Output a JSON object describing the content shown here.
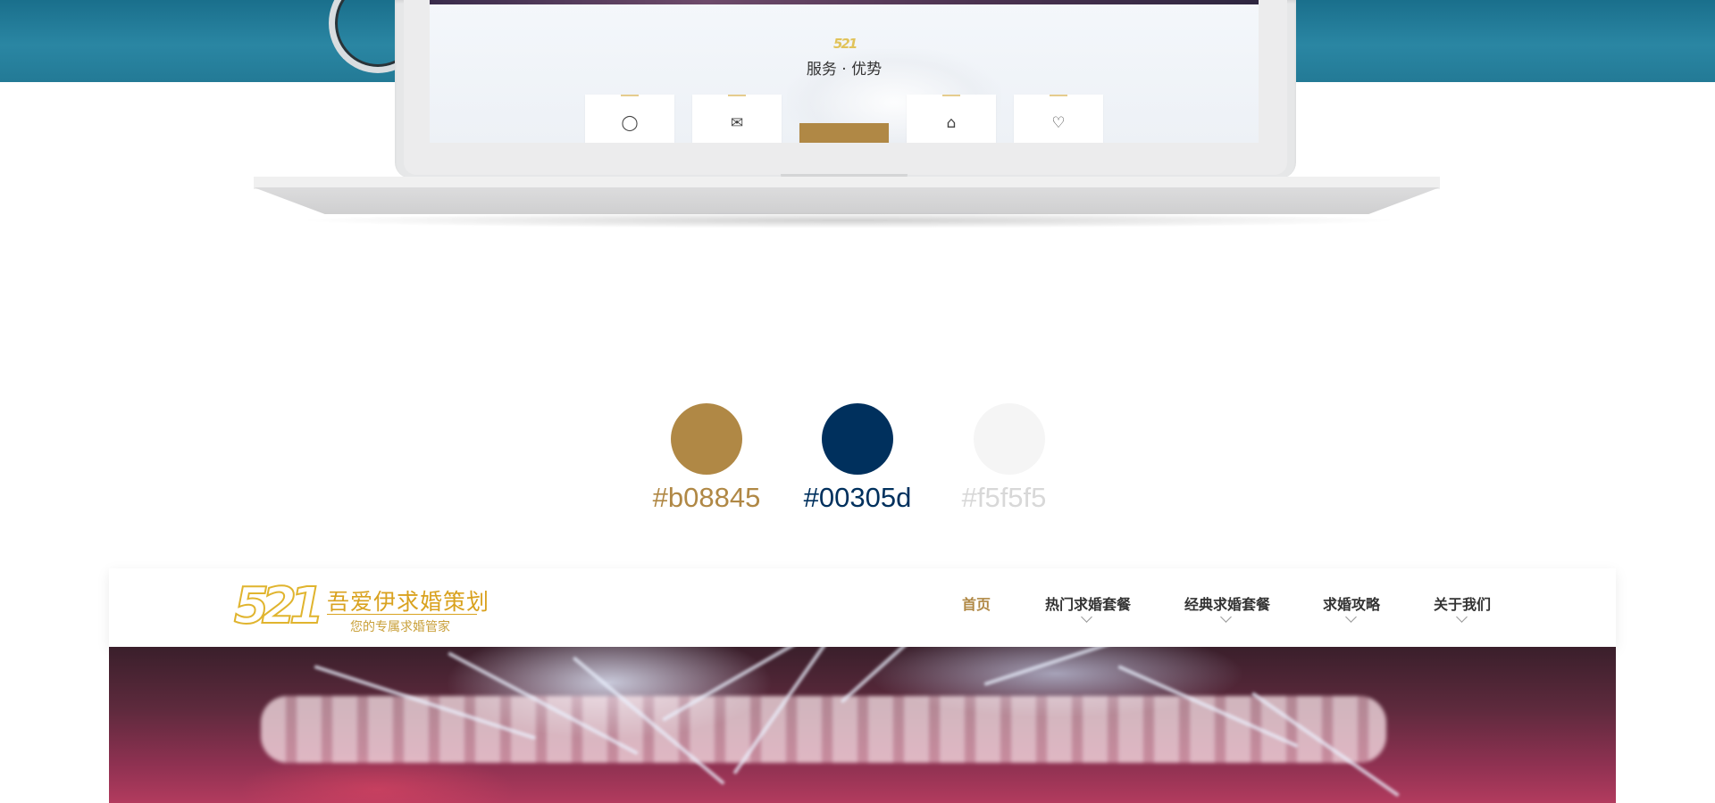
{
  "mockup": {
    "screen_section_title": "服务 · 优势",
    "mini_logo": "521",
    "service_cards": [
      {
        "icon": "ring-icon",
        "glyph": "◯",
        "active": false
      },
      {
        "icon": "envelope-heart-icon",
        "glyph": "✉",
        "active": false
      },
      {
        "icon": "highlight-card",
        "glyph": "",
        "active": true
      },
      {
        "icon": "tag-icon",
        "glyph": "⌂",
        "active": false
      },
      {
        "icon": "shopping-bag-icon",
        "glyph": "♡",
        "active": false
      }
    ]
  },
  "palette": [
    {
      "hex": "#b08845",
      "label": "#b08845",
      "label_color": "#b08845"
    },
    {
      "hex": "#00305d",
      "label": "#00305d",
      "label_color": "#00305d"
    },
    {
      "hex": "#f5f5f5",
      "label": "#f5f5f5",
      "label_color": "#d8d8d8"
    }
  ],
  "site": {
    "logo_mark": "521",
    "brand_name": "吾爱伊求婚策划",
    "brand_tagline": "您的专属求婚管家",
    "nav": [
      {
        "label": "首页",
        "active": true,
        "has_dropdown": false
      },
      {
        "label": "热门求婚套餐",
        "active": false,
        "has_dropdown": true
      },
      {
        "label": "经典求婚套餐",
        "active": false,
        "has_dropdown": true
      },
      {
        "label": "求婚攻略",
        "active": false,
        "has_dropdown": true
      },
      {
        "label": "关于我们",
        "active": false,
        "has_dropdown": true
      }
    ]
  },
  "colors": {
    "accent_gold": "#b08845",
    "navy": "#00305d",
    "light_gray": "#f5f5f5",
    "text_dark": "#333333"
  }
}
